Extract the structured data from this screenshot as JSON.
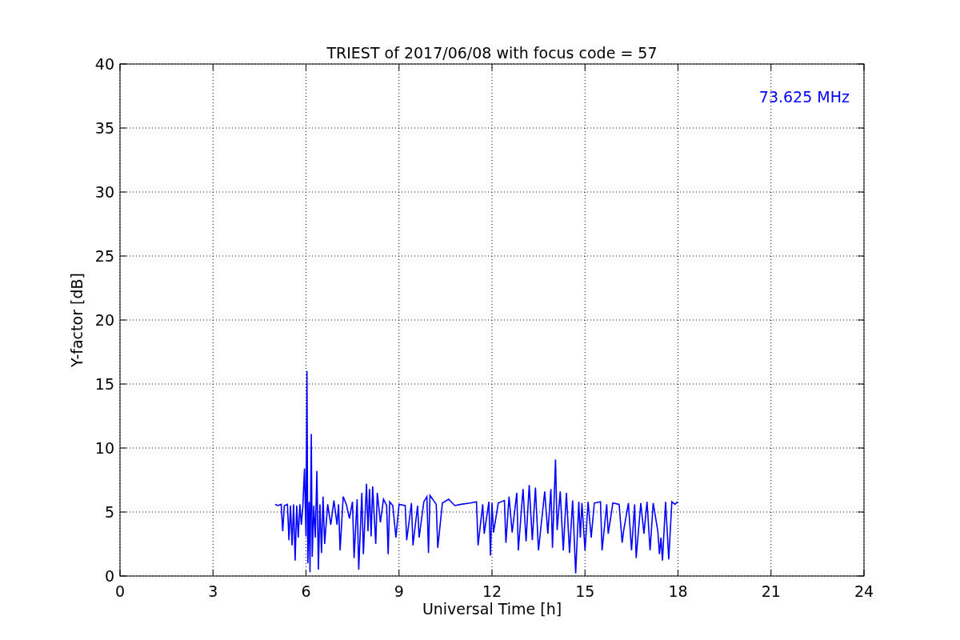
{
  "figure": {
    "chart_data": {
      "type": "line",
      "title": "TRIEST of 2017/06/08 with focus code = 57",
      "xlabel": "Universal Time [h]",
      "ylabel": "Y-factor [dB]",
      "xlim": [
        0,
        24
      ],
      "ylim": [
        0,
        40
      ],
      "xticks": [
        0,
        3,
        6,
        9,
        12,
        15,
        18,
        21,
        24
      ],
      "yticks": [
        0,
        5,
        10,
        15,
        20,
        25,
        30,
        35,
        40
      ],
      "x": [
        5.0,
        5.1,
        5.2,
        5.25,
        5.3,
        5.4,
        5.45,
        5.5,
        5.55,
        5.6,
        5.65,
        5.7,
        5.75,
        5.8,
        5.85,
        5.9,
        5.95,
        6.0,
        6.03,
        6.06,
        6.1,
        6.13,
        6.17,
        6.2,
        6.25,
        6.3,
        6.35,
        6.4,
        6.45,
        6.5,
        6.55,
        6.6,
        6.7,
        6.8,
        6.9,
        7.0,
        7.05,
        7.1,
        7.2,
        7.3,
        7.4,
        7.5,
        7.55,
        7.65,
        7.7,
        7.8,
        7.85,
        7.95,
        8.0,
        8.05,
        8.1,
        8.15,
        8.25,
        8.3,
        8.4,
        8.5,
        8.6,
        8.65,
        8.7,
        8.8,
        8.9,
        9.0,
        9.2,
        9.25,
        9.4,
        9.45,
        9.6,
        9.65,
        9.8,
        9.9,
        9.95,
        10.0,
        10.2,
        10.25,
        10.4,
        10.6,
        10.8,
        11.0,
        11.3,
        11.5,
        11.55,
        11.7,
        11.75,
        11.9,
        11.95,
        12.0,
        12.05,
        12.2,
        12.4,
        12.45,
        12.55,
        12.65,
        12.8,
        12.85,
        13.0,
        13.1,
        13.2,
        13.3,
        13.4,
        13.5,
        13.7,
        13.8,
        13.9,
        13.95,
        14.05,
        14.1,
        14.2,
        14.3,
        14.4,
        14.5,
        14.6,
        14.7,
        14.8,
        14.85,
        14.9,
        15.0,
        15.1,
        15.2,
        15.3,
        15.5,
        15.55,
        15.7,
        15.75,
        15.9,
        16.1,
        16.2,
        16.25,
        16.4,
        16.5,
        16.6,
        16.65,
        16.8,
        16.9,
        17.0,
        17.1,
        17.2,
        17.35,
        17.4,
        17.45,
        17.5,
        17.6,
        17.7,
        17.8,
        17.9,
        18.0
      ],
      "series": [
        {
          "color": "#0000ff",
          "values": [
            5.6,
            5.5,
            5.6,
            3.5,
            5.5,
            5.6,
            2.8,
            5.5,
            2.4,
            5.6,
            1.2,
            5.5,
            3.0,
            5.6,
            4.0,
            5.5,
            8.4,
            3.1,
            16.0,
            1.0,
            5.8,
            0.3,
            11.1,
            1.5,
            5.5,
            3.0,
            8.2,
            0.5,
            5.6,
            1.8,
            6.2,
            2.5,
            5.6,
            4.0,
            5.9,
            4.0,
            5.6,
            2.0,
            6.2,
            5.6,
            4.5,
            5.8,
            1.4,
            6.0,
            0.5,
            6.5,
            1.7,
            7.2,
            3.5,
            6.8,
            3.1,
            7.0,
            2.5,
            6.5,
            4.2,
            6.0,
            5.5,
            1.7,
            5.8,
            5.5,
            3.0,
            5.6,
            5.5,
            2.8,
            5.7,
            2.4,
            5.5,
            3.0,
            5.8,
            6.2,
            1.8,
            6.3,
            5.6,
            2.2,
            5.7,
            6.0,
            5.5,
            5.6,
            5.7,
            5.8,
            2.4,
            5.6,
            3.3,
            5.8,
            1.6,
            5.7,
            3.4,
            5.7,
            5.9,
            2.6,
            6.2,
            3.4,
            6.5,
            2.0,
            6.8,
            2.7,
            7.1,
            2.8,
            6.9,
            2.0,
            6.6,
            3.3,
            6.8,
            2.2,
            9.1,
            3.6,
            6.6,
            2.0,
            6.5,
            1.8,
            5.9,
            0.2,
            5.8,
            3.0,
            5.7,
            2.0,
            5.8,
            3.0,
            5.7,
            5.8,
            2.0,
            5.6,
            3.3,
            5.7,
            5.6,
            2.6,
            3.6,
            5.7,
            2.0,
            5.6,
            1.4,
            5.7,
            3.3,
            5.8,
            2.0,
            5.7,
            3.5,
            1.7,
            3.0,
            1.2,
            5.8,
            1.3,
            5.8,
            5.6,
            5.8
          ]
        }
      ],
      "grid": true,
      "annotations": [
        "73.625 MHz"
      ]
    }
  }
}
